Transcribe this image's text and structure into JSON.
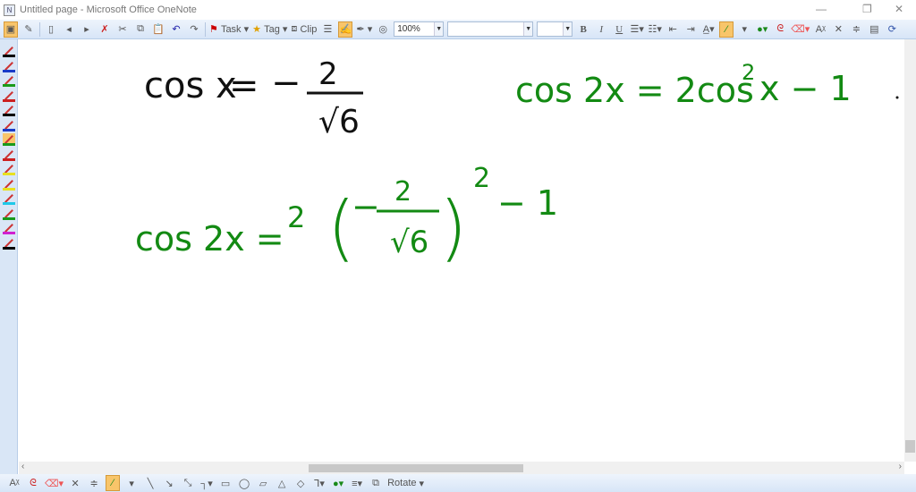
{
  "window": {
    "title": "Untitled page - Microsoft Office OneNote",
    "minimize": "—",
    "restore": "❐",
    "close": "✕"
  },
  "toolbar": {
    "task_label": "Task",
    "tag_label": "Tag",
    "clip_label": "Clip",
    "zoom_value": "100%",
    "font_value": "",
    "size_value": "",
    "bold": "B",
    "italic": "I",
    "underline": "U"
  },
  "drawing_toolbar": {
    "rotate_label": "Rotate"
  },
  "pens": [
    {
      "color": "#000000"
    },
    {
      "color": "#1a3cc8"
    },
    {
      "color": "#1a9a1a"
    },
    {
      "color": "#cc2020"
    },
    {
      "color": "#000000"
    },
    {
      "color": "#1a3cc8"
    },
    {
      "color": "#1a9a1a"
    },
    {
      "color": "#cc2020"
    },
    {
      "color": "#e8e020"
    },
    {
      "color": "#e8e020"
    },
    {
      "color": "#20c8e8"
    },
    {
      "color": "#1a9a1a"
    },
    {
      "color": "#d020d0"
    },
    {
      "color": "#000000"
    }
  ],
  "notes": {
    "eq1": {
      "lhs": "cos x",
      "eq": "=",
      "minus": "−",
      "num": "2",
      "den": "√6"
    },
    "eq2": {
      "text": "cos 2x = 2cos",
      "sup": "2",
      "tail": "x − 1"
    },
    "eq3": {
      "lhs": "cos 2x =",
      "coef": "2",
      "lparen": "(",
      "minus": "−",
      "num": "2",
      "den": "√6",
      "rparen": ")",
      "exp": "2",
      "tail": "− 1"
    }
  },
  "colors": {
    "black_ink": "#111111",
    "green_ink": "#138a13"
  }
}
